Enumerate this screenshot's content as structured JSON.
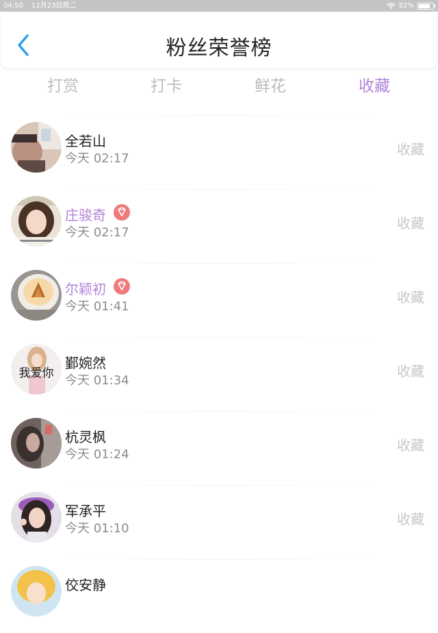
{
  "status": {
    "time": "04:50",
    "date": "12月23日周二",
    "battery": "82%",
    "battery_level": 0.82
  },
  "nav": {
    "title": "粉丝荣誉榜"
  },
  "tabs": [
    {
      "label": "打赏"
    },
    {
      "label": "打卡"
    },
    {
      "label": "鲜花"
    },
    {
      "label": "收藏",
      "active": true
    }
  ],
  "rows": [
    {
      "name": "全若山",
      "time": "今天 02:17",
      "action": "收藏",
      "vip": false
    },
    {
      "name": "庄骏奇",
      "time": "今天 02:17",
      "action": "收藏",
      "vip": true
    },
    {
      "name": "尔颖初",
      "time": "今天 01:41",
      "action": "收藏",
      "vip": true
    },
    {
      "name": "鄞婉然",
      "time": "今天 01:34",
      "action": "收藏",
      "vip": false,
      "avatar_text": "我爱你"
    },
    {
      "name": "杭灵枫",
      "time": "今天 01:24",
      "action": "收藏",
      "vip": false
    },
    {
      "name": "军承平",
      "time": "今天 01:10",
      "action": "收藏",
      "vip": false
    },
    {
      "name": "佼安静",
      "time": "",
      "action": "",
      "vip": false
    }
  ],
  "colors": {
    "accent": "#b384d8",
    "back_arrow": "#2d9cf0",
    "badge": "#f07a7a",
    "muted": "#c6c6c6"
  }
}
